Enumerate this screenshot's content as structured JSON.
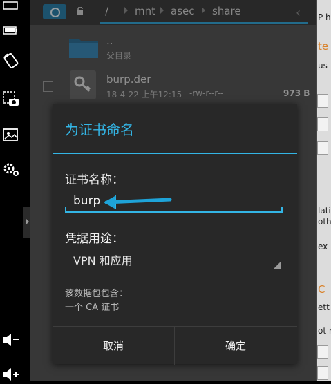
{
  "file_browser": {
    "breadcrumb": [
      "/",
      "mnt",
      "asec",
      "share"
    ],
    "rows": [
      {
        "name": "..",
        "sub": "父目录"
      },
      {
        "name": "burp.der",
        "date": "18-4-22 上午12:15",
        "perms": "-rw-r--r--",
        "size": "973 B"
      }
    ]
  },
  "dialog": {
    "title": "为证书命名",
    "name_label": "证书名称：",
    "name_value": "burp",
    "usage_label": "凭据用途：",
    "usage_value": "VPN 和应用",
    "info_line1": "该数据包包含：",
    "info_line2": "一个 CA 证书",
    "cancel": "取消",
    "ok": "确定"
  },
  "right_window": {
    "fragments": [
      "P h",
      "te",
      "us-",
      "lati",
      "othe",
      "ex",
      "C",
      "ett",
      "ot r"
    ]
  },
  "colors": {
    "accent": "#33b5e5",
    "dialog_bg": "#282828",
    "annotation_arrow": "#1ea3d8"
  },
  "icons": {
    "sidebar": [
      "keyboard-icon",
      "battery-icon",
      "rotate-icon",
      "screenshot-icon",
      "gallery-icon",
      "settings-icon",
      "volume-down-icon",
      "volume-up-icon"
    ],
    "storage": "sd-card-icon",
    "lock": "lock-open-icon",
    "folder": "folder-icon",
    "file": "key-file-icon"
  }
}
